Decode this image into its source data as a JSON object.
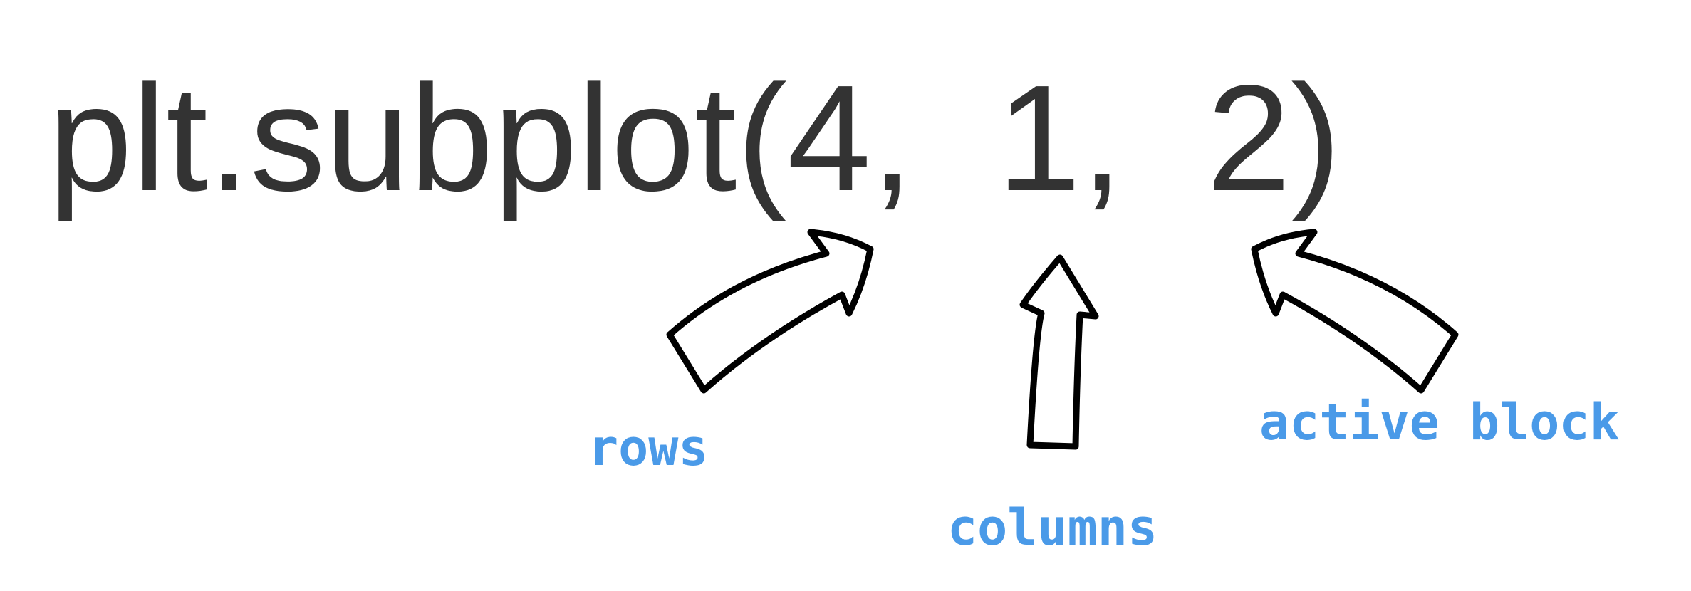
{
  "code": {
    "text": "plt.subplot(4,  1,  2)",
    "color": "#333333"
  },
  "labels": {
    "rows": "rows",
    "columns": "columns",
    "active_block": "active block",
    "color": "#4a9ae8"
  }
}
